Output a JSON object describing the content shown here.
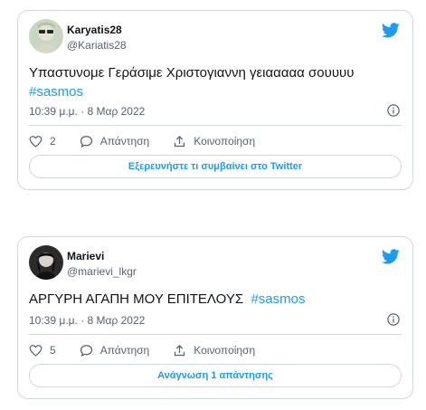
{
  "tweets": [
    {
      "display_name": "Karyatis28",
      "handle": "@Kariatis28",
      "text": "Υπαστυνομε Γεράσιμε Χριστογιαννη γειααααα σουυυυ",
      "hashtag": "#sasmos",
      "timestamp": "10:39 μ.μ. · 8 Μαρ 2022",
      "like_count": "2",
      "reply_label": "Απάντηση",
      "share_label": "Κοινοποίηση",
      "cta_label": "Εξερευνήστε τι συμβαίνει στο Twitter"
    },
    {
      "display_name": "Marievi",
      "handle": "@marievi_lkgr",
      "text": "ΑΡΓΥΡΗ ΑΓΑΠΗ ΜΟΥ ΕΠΙΤΕΛΟΥΣ",
      "hashtag": "#sasmos",
      "timestamp": "10:39 μ.μ. · 8 Μαρ 2022",
      "like_count": "5",
      "reply_label": "Απάντηση",
      "share_label": "Κοινοποίηση",
      "cta_label": "Ανάγνωση 1 απάντησης"
    }
  ],
  "icons": {
    "brand": "twitter-bird-icon",
    "like": "heart-icon",
    "reply": "speech-bubble-icon",
    "share": "share-arrow-icon",
    "info": "info-icon"
  },
  "colors": {
    "accent": "#1d9bf0",
    "secondary_text": "#536471",
    "border": "#cfd9de"
  }
}
